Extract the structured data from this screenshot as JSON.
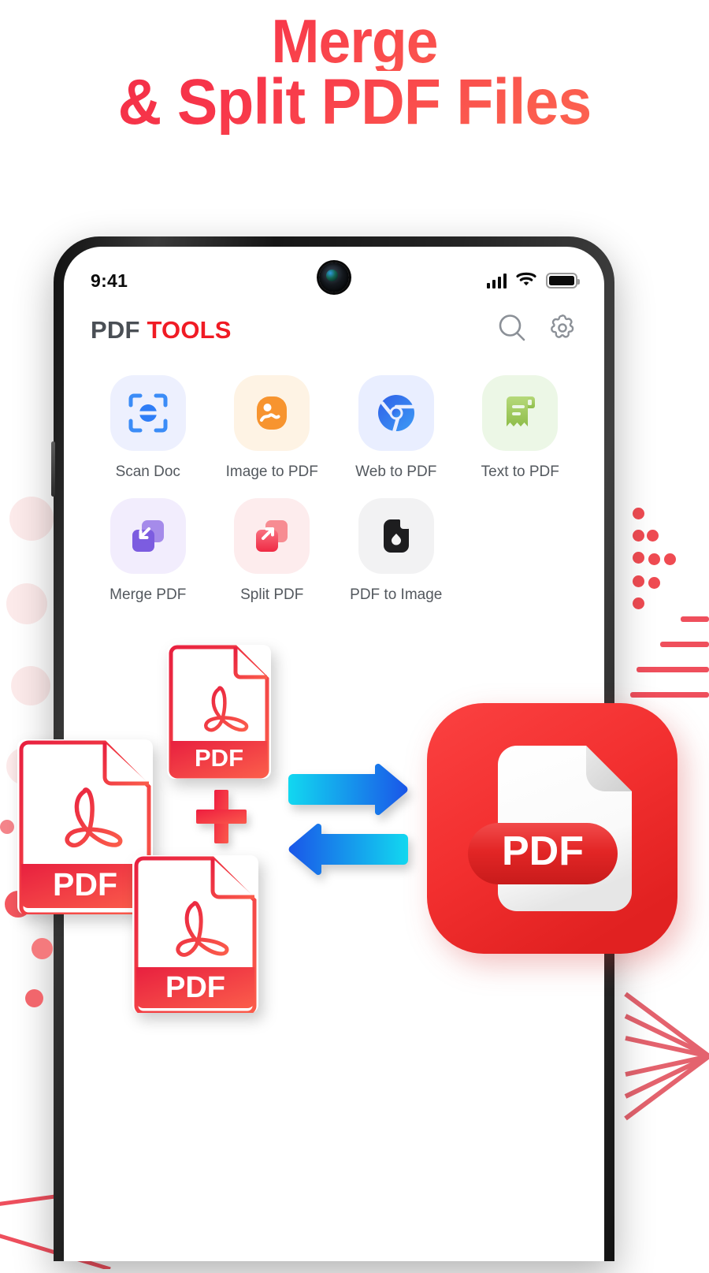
{
  "headline": {
    "line1": "Merge",
    "line2": "& Split PDF Files",
    "gradient_from": "#f02a46",
    "gradient_to": "#fd6a52"
  },
  "phone": {
    "statusbar": {
      "time": "9:41",
      "signal_icon": "signal-bars-icon",
      "wifi_icon": "wifi-icon",
      "battery_icon": "battery-icon",
      "camera_icon": "front-camera-icon"
    },
    "appbar": {
      "brand_part1": "PDF",
      "brand_part2": "TOOLS",
      "brand_part1_color": "#4a4f55",
      "brand_part2_color": "#f01b24",
      "search_icon": "search-icon",
      "settings_icon": "gear-icon"
    },
    "tools": [
      {
        "label": "Scan Doc",
        "icon": "scan-doc-icon",
        "tile_color": "#edf0fe",
        "accent": "#2f7df6"
      },
      {
        "label": "Image to PDF",
        "icon": "image-to-pdf-icon",
        "tile_color": "#fef3e4",
        "accent": "#f7942f"
      },
      {
        "label": "Web to PDF",
        "icon": "web-to-pdf-icon",
        "tile_color": "#e9eeff",
        "accent": "#2f6ff0"
      },
      {
        "label": "Text to PDF",
        "icon": "text-to-pdf-icon",
        "tile_color": "#ecf7e6",
        "accent": "#9cc95a"
      },
      {
        "label": "Merge PDF",
        "icon": "merge-pdf-icon",
        "tile_color": "#f2edfd",
        "accent": "#7c5ce0"
      },
      {
        "label": "Split PDF",
        "icon": "split-pdf-icon",
        "tile_color": "#fdeced",
        "accent": "#f1394e"
      },
      {
        "label": "PDF to Image",
        "icon": "pdf-to-image-icon",
        "tile_color": "#f2f2f3",
        "accent": "#1d1d1f"
      }
    ]
  },
  "illustration": {
    "pdf_cards": [
      {
        "label": "PDF",
        "name": "pdf-card-top"
      },
      {
        "label": "PDF",
        "name": "pdf-card-left"
      },
      {
        "label": "PDF",
        "name": "pdf-card-bottom"
      }
    ],
    "plus_symbol": "+",
    "plus_color": "#f2304a",
    "arrow_right": "arrow-right-icon",
    "arrow_left": "arrow-left-icon",
    "arrow_gradient_from": "#12d8f0",
    "arrow_gradient_to": "#1a56e8",
    "result_badge": {
      "label": "PDF",
      "badge_color": "#f23333",
      "pill_color": "#e8252a"
    }
  },
  "decor": {
    "dot_color": "#ef4b52",
    "line_color": "#ef4f5c",
    "chevron_color": "#e4636e",
    "soft_circle_color": "#fbe3e3"
  }
}
